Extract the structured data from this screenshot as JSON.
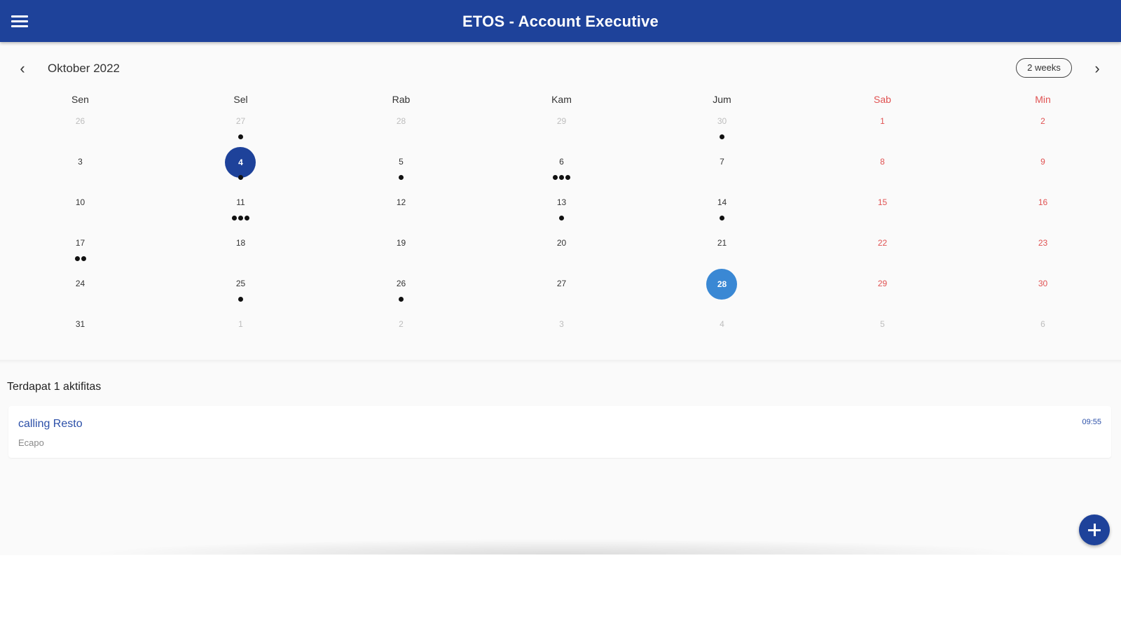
{
  "app": {
    "title": "ETOS - Account Executive"
  },
  "calendar": {
    "month_label": "Oktober 2022",
    "format_label": "2 weeks",
    "weekdays": [
      {
        "label": "Sen",
        "weekend": false
      },
      {
        "label": "Sel",
        "weekend": false
      },
      {
        "label": "Rab",
        "weekend": false
      },
      {
        "label": "Kam",
        "weekend": false
      },
      {
        "label": "Jum",
        "weekend": false
      },
      {
        "label": "Sab",
        "weekend": true
      },
      {
        "label": "Min",
        "weekend": true
      }
    ],
    "weeks": [
      [
        {
          "day": "26",
          "outside": true,
          "markers": 0
        },
        {
          "day": "27",
          "outside": true,
          "markers": 1
        },
        {
          "day": "28",
          "outside": true,
          "markers": 0
        },
        {
          "day": "29",
          "outside": true,
          "markers": 0
        },
        {
          "day": "30",
          "outside": true,
          "markers": 1
        },
        {
          "day": "1",
          "outside": false,
          "markers": 0
        },
        {
          "day": "2",
          "outside": false,
          "markers": 0
        }
      ],
      [
        {
          "day": "3",
          "outside": false,
          "markers": 0
        },
        {
          "day": "4",
          "outside": false,
          "markers": 1,
          "selected": true
        },
        {
          "day": "5",
          "outside": false,
          "markers": 1
        },
        {
          "day": "6",
          "outside": false,
          "markers": 3
        },
        {
          "day": "7",
          "outside": false,
          "markers": 0
        },
        {
          "day": "8",
          "outside": false,
          "markers": 0
        },
        {
          "day": "9",
          "outside": false,
          "markers": 0
        }
      ],
      [
        {
          "day": "10",
          "outside": false,
          "markers": 0
        },
        {
          "day": "11",
          "outside": false,
          "markers": 3
        },
        {
          "day": "12",
          "outside": false,
          "markers": 0
        },
        {
          "day": "13",
          "outside": false,
          "markers": 1
        },
        {
          "day": "14",
          "outside": false,
          "markers": 1
        },
        {
          "day": "15",
          "outside": false,
          "markers": 0
        },
        {
          "day": "16",
          "outside": false,
          "markers": 0
        }
      ],
      [
        {
          "day": "17",
          "outside": false,
          "markers": 2
        },
        {
          "day": "18",
          "outside": false,
          "markers": 0
        },
        {
          "day": "19",
          "outside": false,
          "markers": 0
        },
        {
          "day": "20",
          "outside": false,
          "markers": 0
        },
        {
          "day": "21",
          "outside": false,
          "markers": 0
        },
        {
          "day": "22",
          "outside": false,
          "markers": 0
        },
        {
          "day": "23",
          "outside": false,
          "markers": 0
        }
      ],
      [
        {
          "day": "24",
          "outside": false,
          "markers": 0
        },
        {
          "day": "25",
          "outside": false,
          "markers": 1
        },
        {
          "day": "26",
          "outside": false,
          "markers": 1
        },
        {
          "day": "27",
          "outside": false,
          "markers": 0
        },
        {
          "day": "28",
          "outside": false,
          "markers": 0,
          "today": true
        },
        {
          "day": "29",
          "outside": false,
          "markers": 0
        },
        {
          "day": "30",
          "outside": false,
          "markers": 0
        }
      ],
      [
        {
          "day": "31",
          "outside": false,
          "markers": 0
        },
        {
          "day": "1",
          "outside": true,
          "markers": 0
        },
        {
          "day": "2",
          "outside": true,
          "markers": 0
        },
        {
          "day": "3",
          "outside": true,
          "markers": 0
        },
        {
          "day": "4",
          "outside": true,
          "markers": 0
        },
        {
          "day": "5",
          "outside": true,
          "markers": 0
        },
        {
          "day": "6",
          "outside": true,
          "markers": 0
        }
      ]
    ]
  },
  "events": {
    "count_label": "Terdapat 1 aktifitas",
    "items": [
      {
        "title": "calling Resto",
        "subtitle": "Ecapo",
        "time": "09:55"
      }
    ]
  },
  "icons": {
    "menu": "hamburger-menu-icon",
    "prev": "chevron-left-icon",
    "next": "chevron-right-icon",
    "add": "plus-icon"
  },
  "colors": {
    "primary": "#1e429a",
    "today": "#3a88d4",
    "weekend": "#e05252",
    "event_title": "#2b4fa8"
  }
}
